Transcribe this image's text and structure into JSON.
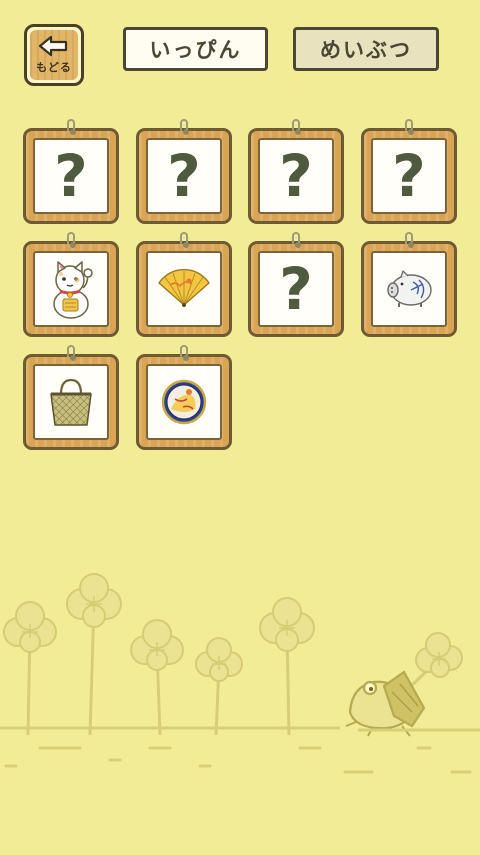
{
  "header": {
    "back_label": "もどる",
    "tabs": [
      {
        "label": "いっぴん",
        "selected": false
      },
      {
        "label": "めいぶつ",
        "selected": true
      }
    ]
  },
  "cards": [
    {
      "state": "unknown",
      "glyph": "?"
    },
    {
      "state": "unknown",
      "glyph": "?"
    },
    {
      "state": "unknown",
      "glyph": "?"
    },
    {
      "state": "unknown",
      "glyph": "?"
    },
    {
      "state": "owned",
      "icon": "maneki-neko-icon"
    },
    {
      "state": "owned",
      "icon": "folding-fan-icon"
    },
    {
      "state": "unknown",
      "glyph": "?"
    },
    {
      "state": "owned",
      "icon": "pig-mosquito-coil-holder-icon"
    },
    {
      "state": "owned",
      "icon": "woven-basket-bag-icon"
    },
    {
      "state": "owned",
      "icon": "round-plate-icon"
    }
  ],
  "colors": {
    "background": "#f3ec96",
    "frame_wood": "#d9a554",
    "outline": "#4c4734",
    "clover": "#e6dc80"
  }
}
